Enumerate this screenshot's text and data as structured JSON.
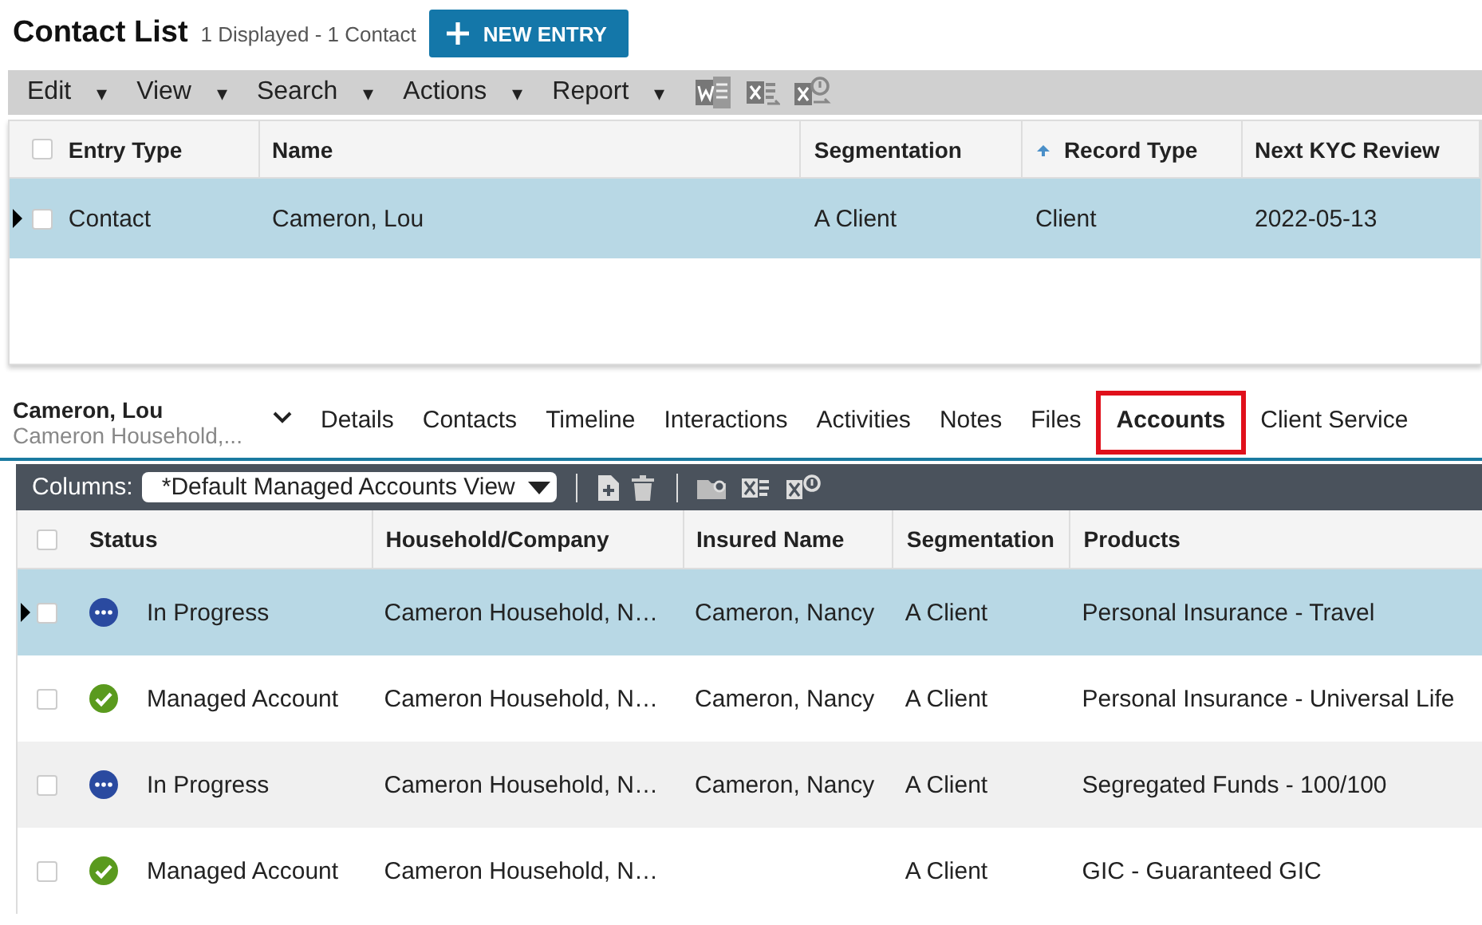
{
  "header": {
    "title": "Contact List",
    "summary": "1 Displayed - 1 Contact",
    "new_button": "NEW ENTRY"
  },
  "menu": [
    {
      "label": "Edit",
      "caret": "▾"
    },
    {
      "label": "View",
      "caret": "▾"
    },
    {
      "label": "Search",
      "caret": "▾"
    },
    {
      "label": "Actions",
      "caret": "▾"
    },
    {
      "label": "Report",
      "caret": "▾"
    }
  ],
  "contacts_table": {
    "columns": [
      {
        "label": "Entry Type",
        "sorted": false
      },
      {
        "label": "Name",
        "sorted": false
      },
      {
        "label": "Segmentation",
        "sorted": false
      },
      {
        "label": "Record Type",
        "sorted": true
      },
      {
        "label": "Next KYC Review",
        "sorted": false
      }
    ],
    "select_all_checked": false,
    "rows": [
      {
        "selected": true,
        "checked": false,
        "cells": [
          "Contact",
          "Cameron, Lou",
          "A Client",
          "Client",
          "2022-05-13"
        ]
      }
    ]
  },
  "detail": {
    "name": "Cameron, Lou",
    "subtitle": "Cameron Household,...",
    "tabs": [
      {
        "label": "Details",
        "selected": false,
        "highlighted": false
      },
      {
        "label": "Contacts",
        "selected": false,
        "highlighted": false
      },
      {
        "label": "Timeline",
        "selected": false,
        "highlighted": false
      },
      {
        "label": "Interactions",
        "selected": false,
        "highlighted": false
      },
      {
        "label": "Activities",
        "selected": false,
        "highlighted": false
      },
      {
        "label": "Notes",
        "selected": false,
        "highlighted": false
      },
      {
        "label": "Files",
        "selected": false,
        "highlighted": false
      },
      {
        "label": "Accounts",
        "selected": true,
        "highlighted": true
      },
      {
        "label": "Client Service",
        "selected": false,
        "highlighted": false
      }
    ]
  },
  "accounts_toolbar": {
    "columns_label": "Columns:",
    "view": "*Default Managed Accounts View"
  },
  "accounts_table": {
    "columns": [
      "Status",
      "Household/Company",
      "Insured Name",
      "Segmentation",
      "Products"
    ],
    "select_all_checked": false,
    "rows": [
      {
        "selected": true,
        "checked": false,
        "kind": "in_progress",
        "cells": [
          "In Progress",
          "Cameron Household, N…",
          "Cameron, Nancy",
          "A Client",
          "Personal Insurance - Travel"
        ]
      },
      {
        "selected": false,
        "checked": false,
        "kind": "managed",
        "cells": [
          "Managed Account",
          "Cameron Household, N…",
          "Cameron, Nancy",
          "A Client",
          "Personal Insurance - Universal Life"
        ]
      },
      {
        "selected": false,
        "checked": false,
        "kind": "in_progress",
        "cells": [
          "In Progress",
          "Cameron Household, N…",
          "Cameron, Nancy",
          "A Client",
          "Segregated Funds - 100/100"
        ]
      },
      {
        "selected": false,
        "checked": false,
        "kind": "managed",
        "cells": [
          "Managed Account",
          "Cameron Household, N…",
          "",
          "A Client",
          "GIC - Guaranteed GIC"
        ]
      }
    ]
  }
}
